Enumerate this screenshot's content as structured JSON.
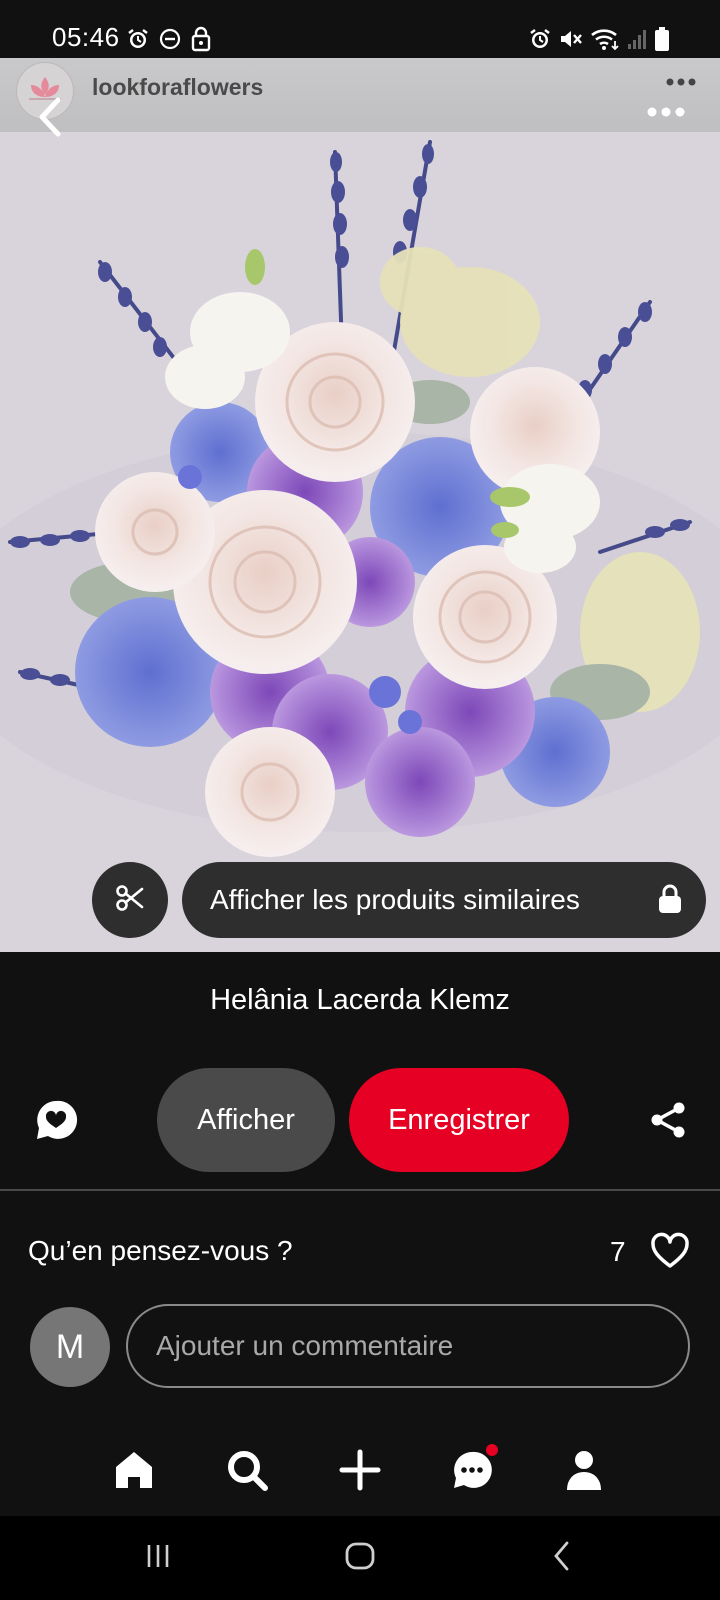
{
  "status_bar": {
    "time": "05:46"
  },
  "header": {
    "account_name": "lookforaflowers"
  },
  "image": {
    "subject": "bouquet"
  },
  "overlay": {
    "similar_products_label": "Afficher les produits similaires"
  },
  "pin": {
    "author": "Helânia Lacerda Klemz"
  },
  "actions": {
    "view_label": "Afficher",
    "save_label": "Enregistrer"
  },
  "comments": {
    "title": "Qu’en pensez-vous ?",
    "like_count": "7",
    "avatar_initial": "M",
    "input_placeholder": "Ajouter un commentaire"
  },
  "colors": {
    "accent": "#e60023",
    "background": "#111111",
    "secondary_button": "#4a4a4a"
  },
  "icons": {
    "back": "chevron-left-icon",
    "more": "more-horizontal-icon",
    "scissors": "scissors-icon",
    "lock": "lock-icon",
    "comment": "comment-bubble-icon",
    "share": "share-icon",
    "heart": "heart-outline-icon",
    "nav": [
      "home-icon",
      "search-icon",
      "plus-icon",
      "messages-icon",
      "profile-icon"
    ]
  }
}
